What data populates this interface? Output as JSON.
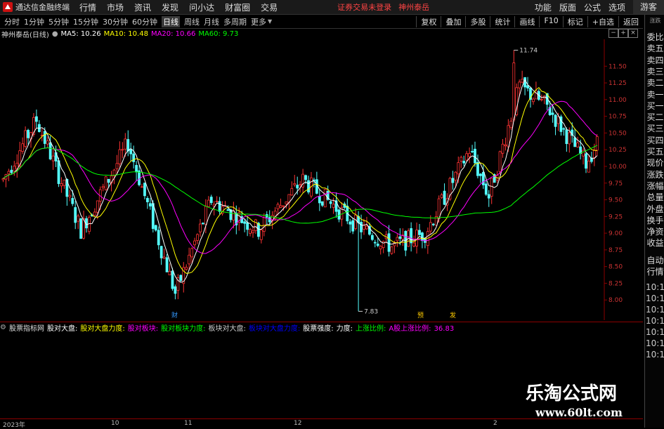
{
  "menubar": {
    "brand": "通达信金融终端",
    "items": [
      "行情",
      "市场",
      "资讯",
      "发现",
      "问小达",
      "财富圈",
      "交易"
    ],
    "login_alert": "证券交易未登录",
    "stock_name": "神州泰岳",
    "right_items": [
      "功能",
      "版面",
      "公式",
      "选项"
    ],
    "guest": "游客"
  },
  "tabs": [
    "分时",
    "1分钟",
    "5分钟",
    "15分钟",
    "30分钟",
    "60分钟",
    "日线",
    "周线",
    "月线",
    "多周期",
    "更多"
  ],
  "active_tab": "日线",
  "tools": [
    "复权",
    "叠加",
    "多股",
    "统计",
    "画线",
    "F10",
    "标记",
    "+自选",
    "返回"
  ],
  "chart_info": {
    "title": "神州泰岳(日线)",
    "ma5": "MA5: 10.26",
    "ma10": "MA10: 10.48",
    "ma20": "MA20: 10.66",
    "ma60": "MA60: 9.73"
  },
  "indicator_bar": {
    "name": "股票指标网",
    "items": [
      "股对大盘:",
      "股对大盘力度:",
      "股对板块:",
      "股对板块力度:",
      "板块对大盘:",
      "板块对大盘力度:",
      "股票强度:",
      "力度:",
      "上涨比例:",
      "A股上涨比例:",
      "36.83"
    ],
    "colors": [
      "#ffffff",
      "#ffff00",
      "#ff00ff",
      "#00ff00",
      "#cccccc",
      "#0000ff",
      "#ffffff",
      "#ffffff",
      "#00ff00",
      "#ff00ff",
      "#ff00ff"
    ]
  },
  "sidebar": {
    "top_small": "涨跌",
    "labels": [
      "委比",
      "卖五",
      "卖四",
      "卖三",
      "卖二",
      "卖一",
      "买一",
      "买二",
      "买三",
      "买四",
      "买五",
      "现价",
      "涨跌",
      "涨幅",
      "总量",
      "外盘",
      "换手",
      "净资",
      "收益"
    ],
    "bottom": [
      "自动",
      "行情"
    ],
    "times": [
      "10:1",
      "10:1",
      "10:1",
      "10:1",
      "10:1",
      "10:1",
      "10:1"
    ]
  },
  "chart_data": {
    "type": "candlestick",
    "y_ticks": [
      "11.50",
      "11.25",
      "11.00",
      "10.75",
      "10.50",
      "10.25",
      "10.00",
      "9.75",
      "9.50",
      "9.25",
      "9.00",
      "8.75",
      "8.50",
      "8.25",
      "8.00"
    ],
    "ylim": [
      7.75,
      11.85
    ],
    "annotations": [
      {
        "text": "11.74",
        "value": 11.74
      },
      {
        "text": "7.83",
        "value": 7.83
      }
    ],
    "markers": [
      {
        "text": "财",
        "color": "#3399ff"
      },
      {
        "text": "预",
        "color": "#ffcc00"
      },
      {
        "text": "发",
        "color": "#ffcc00"
      }
    ],
    "x_ticks": [
      "2023年",
      "10",
      "11",
      "12",
      "2"
    ],
    "colors": {
      "up": "#ff3333",
      "down": "#54ffff",
      "ma5": "#ffffff",
      "ma10": "#ffff00",
      "ma20": "#ff00ff",
      "ma60": "#00ff00"
    }
  },
  "watermark": {
    "cn": "乐淘公式网",
    "url": "www.60lt.com"
  }
}
